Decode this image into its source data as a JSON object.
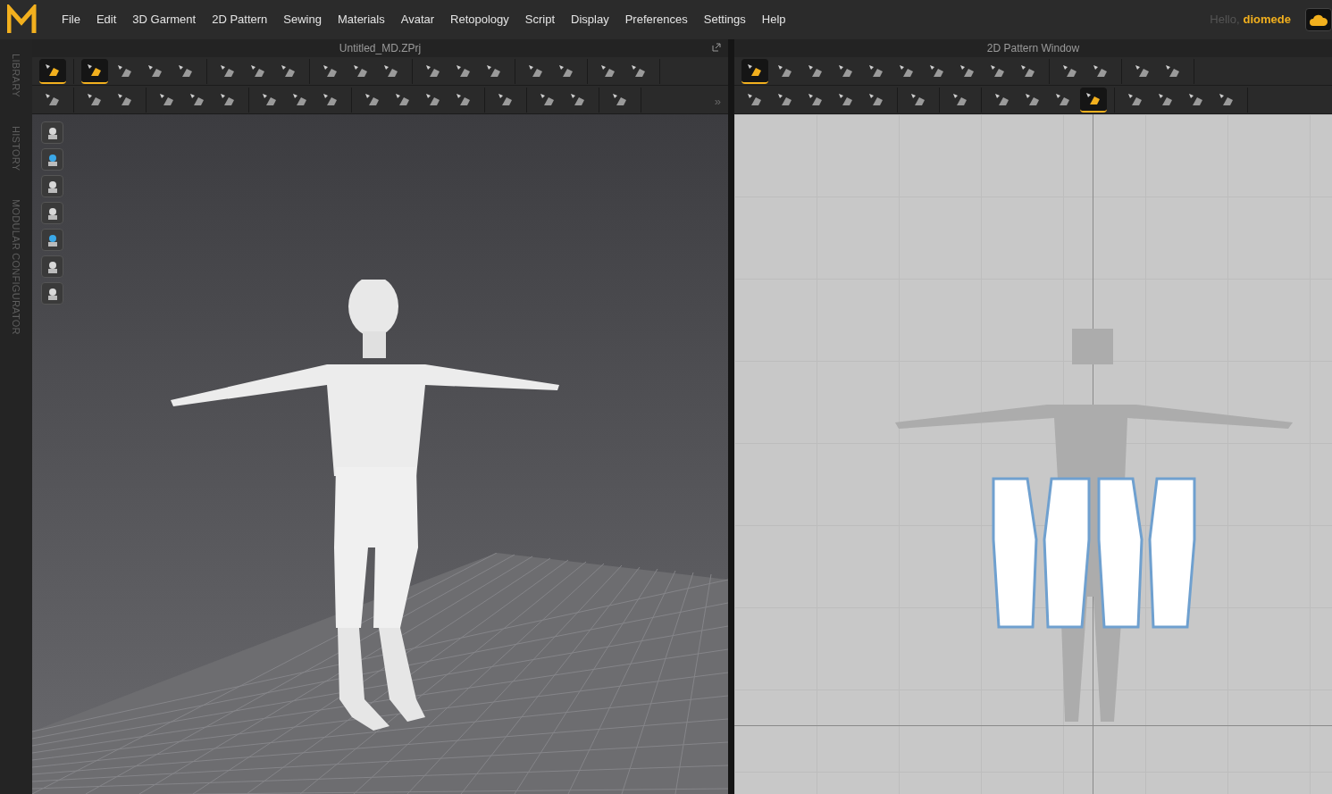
{
  "menu": [
    "File",
    "Edit",
    "3D Garment",
    "2D Pattern",
    "Sewing",
    "Materials",
    "Avatar",
    "Retopology",
    "Script",
    "Display",
    "Preferences",
    "Settings",
    "Help"
  ],
  "user": {
    "greeting": "Hello,",
    "name": "diomede"
  },
  "side_tabs": [
    "LIBRARY",
    "HISTORY",
    "MODULAR CONFIGURATOR"
  ],
  "window_3d": {
    "title": "Untitled_MD.ZPrj",
    "toolbar_rows": [
      [
        [
          {
            "selected": true
          }
        ],
        [
          {
            "selected": true
          },
          {
            "selected": false
          },
          {
            "selected": false
          },
          {
            "selected": false
          }
        ],
        [
          {
            "selected": false
          },
          {
            "selected": false
          },
          {
            "selected": false
          }
        ],
        [
          {
            "selected": false
          },
          {
            "selected": false
          },
          {
            "selected": false
          }
        ],
        [
          {
            "selected": false
          },
          {
            "selected": false
          },
          {
            "selected": false
          }
        ],
        [
          {
            "selected": false
          },
          {
            "selected": false
          }
        ],
        [
          {
            "selected": false
          },
          {
            "selected": false
          }
        ]
      ],
      [
        [
          {
            "selected": false
          }
        ],
        [
          {
            "selected": false
          },
          {
            "selected": false
          }
        ],
        [
          {
            "selected": false
          },
          {
            "selected": false
          },
          {
            "selected": false
          }
        ],
        [
          {
            "selected": false
          },
          {
            "selected": false
          },
          {
            "selected": false
          }
        ],
        [
          {
            "selected": false
          },
          {
            "selected": false
          },
          {
            "selected": false
          },
          {
            "selected": false
          }
        ],
        [
          {
            "selected": false
          }
        ],
        [
          {
            "selected": false
          },
          {
            "selected": false
          }
        ],
        [
          {
            "selected": false
          }
        ]
      ]
    ],
    "overflow": "»",
    "view_tools": [
      {
        "selected": false
      },
      {
        "selected": false
      },
      {
        "selected": false
      },
      {
        "selected": false
      },
      {
        "selected": false
      },
      {
        "selected": false
      },
      {
        "selected": false
      }
    ]
  },
  "window_2d": {
    "title": "2D Pattern Window",
    "toolbar_rows": [
      [
        [
          {
            "selected": true
          },
          {
            "selected": false
          },
          {
            "selected": false
          },
          {
            "selected": false
          },
          {
            "selected": false
          },
          {
            "selected": false
          },
          {
            "selected": false
          },
          {
            "selected": false
          },
          {
            "selected": false
          },
          {
            "selected": false
          }
        ],
        [
          {
            "selected": false
          },
          {
            "selected": false
          }
        ],
        [
          {
            "selected": false
          },
          {
            "selected": false
          }
        ]
      ],
      [
        [
          {
            "selected": false
          },
          {
            "selected": false
          },
          {
            "selected": false
          },
          {
            "selected": false
          },
          {
            "selected": false
          }
        ],
        [
          {
            "selected": false
          }
        ],
        [
          {
            "selected": false
          }
        ],
        [
          {
            "selected": false
          },
          {
            "selected": false
          },
          {
            "selected": false
          },
          {
            "selected": true
          }
        ],
        [
          {
            "selected": false
          },
          {
            "selected": false
          },
          {
            "selected": false
          },
          {
            "selected": false
          }
        ]
      ]
    ],
    "pattern_pieces": [
      {
        "selected": true
      },
      {
        "selected": true
      },
      {
        "selected": true
      },
      {
        "selected": true
      }
    ]
  }
}
